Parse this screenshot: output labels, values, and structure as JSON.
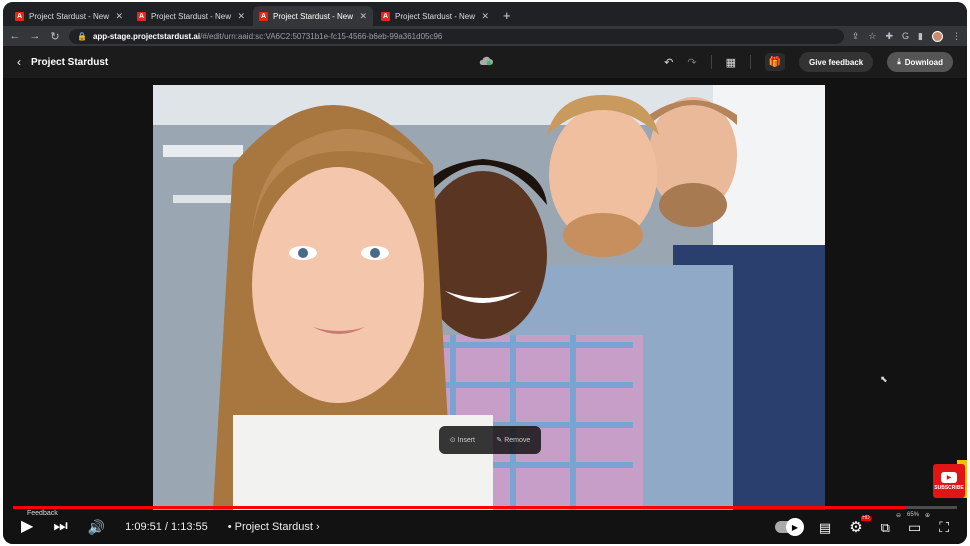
{
  "browser": {
    "tabs": [
      {
        "title": "Project Stardust - New Project",
        "active": false
      },
      {
        "title": "Project Stardust - New Project",
        "active": false
      },
      {
        "title": "Project Stardust - New Project",
        "active": true
      },
      {
        "title": "Project Stardust - New Project",
        "active": false
      }
    ],
    "new_tab": "+",
    "url_host": "app-stage.projectstardust.ai",
    "url_path": "/#/edit/urn:aaid:sc:VA6C2:50731b1e-fc15-4566-b6eb-99a361d05c96"
  },
  "app": {
    "title": "Project Stardust",
    "feedback_label": "Give feedback",
    "download_label": "Download"
  },
  "canvas": {
    "popup_insert": "Insert",
    "popup_remove": "Remove"
  },
  "player": {
    "current_time": "1:09:51",
    "total_time": "1:13:55",
    "time_separator": " / ",
    "chapter": "Project Stardust",
    "progress": 0.945,
    "feedback_tip": "Feedback",
    "zoom_level": "65%",
    "hd_badge": "HD",
    "subscribe": "SUBSCRIBE"
  },
  "colors": {
    "accent": "#ff0000",
    "brand_red": "#e5261f"
  }
}
